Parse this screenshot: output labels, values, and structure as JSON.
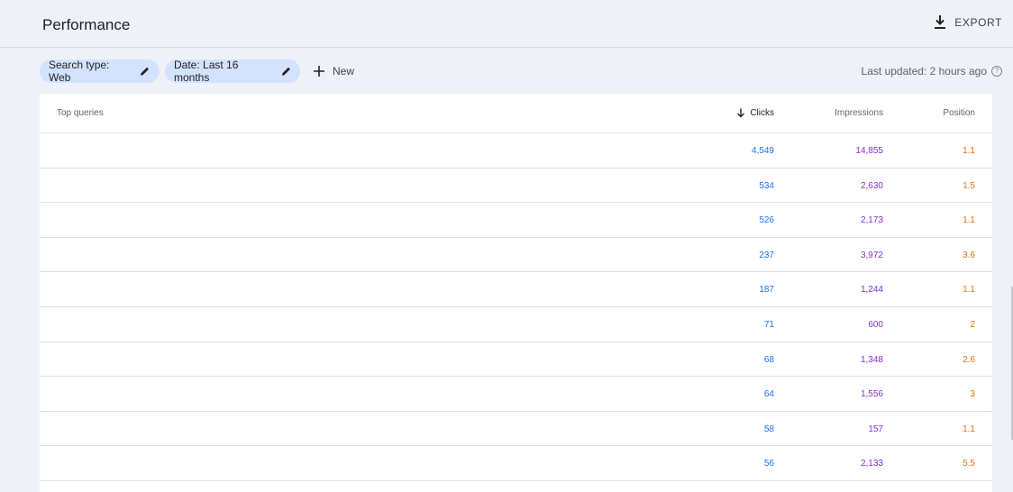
{
  "header": {
    "title": "Performance",
    "export_label": "EXPORT"
  },
  "filters": {
    "search_type": "Search type: Web",
    "date": "Date: Last 16 months",
    "new_label": "New",
    "last_updated": "Last updated: 2 hours ago"
  },
  "table": {
    "headers": {
      "query": "Top queries",
      "clicks": "Clicks",
      "impressions": "Impressions",
      "position": "Position"
    },
    "rows": [
      {
        "query": "",
        "clicks": "4,549",
        "impressions": "14,855",
        "position": "1.1"
      },
      {
        "query": "",
        "clicks": "534",
        "impressions": "2,630",
        "position": "1.5"
      },
      {
        "query": "",
        "clicks": "526",
        "impressions": "2,173",
        "position": "1.1"
      },
      {
        "query": "",
        "clicks": "237",
        "impressions": "3,972",
        "position": "3.6"
      },
      {
        "query": "",
        "clicks": "187",
        "impressions": "1,244",
        "position": "1.1"
      },
      {
        "query": "",
        "clicks": "71",
        "impressions": "600",
        "position": "2"
      },
      {
        "query": "",
        "clicks": "68",
        "impressions": "1,348",
        "position": "2.6"
      },
      {
        "query": "",
        "clicks": "64",
        "impressions": "1,556",
        "position": "3"
      },
      {
        "query": "",
        "clicks": "58",
        "impressions": "157",
        "position": "1.1"
      },
      {
        "query": "",
        "clicks": "56",
        "impressions": "2,133",
        "position": "5.5"
      }
    ]
  },
  "colors": {
    "clicks": "#1a73e8",
    "impressions": "#8430ce",
    "position": "#e8710a",
    "chip_bg": "#d3e3fd",
    "page_bg": "#eef2f8"
  },
  "icons": {
    "export": "download-icon",
    "edit": "pencil-icon",
    "new": "plus-icon",
    "help": "help-circle-icon",
    "sort": "arrow-down-icon"
  }
}
